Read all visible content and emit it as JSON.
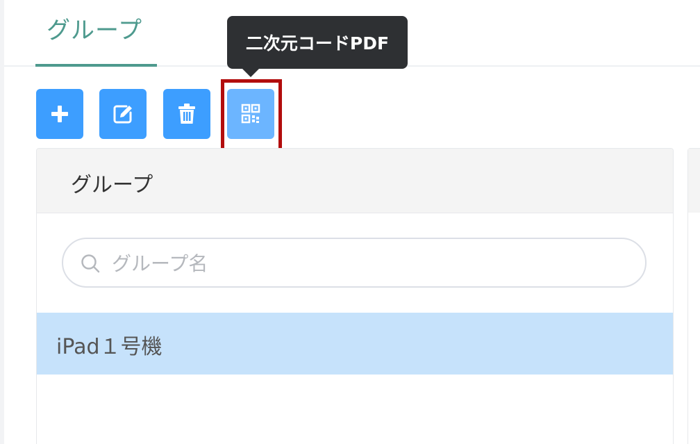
{
  "tabs": [
    {
      "label": "グループ",
      "active": true
    }
  ],
  "tooltip": {
    "text": "二次元コードPDF"
  },
  "toolbar": {
    "buttons": [
      {
        "name": "add",
        "icon": "plus-icon"
      },
      {
        "name": "edit",
        "icon": "edit-icon"
      },
      {
        "name": "delete",
        "icon": "trash-icon"
      },
      {
        "name": "qr-pdf",
        "icon": "qr-code-icon",
        "hovered": true,
        "highlighted": true
      }
    ],
    "button_color": "#3d9eff",
    "button_hover_color": "#6cb5ff",
    "highlight_color": "#b20d0d"
  },
  "panel": {
    "title": "グループ",
    "search": {
      "placeholder": "グループ名",
      "value": "",
      "icon": "search-icon"
    },
    "items": [
      {
        "label": "iPad１号機",
        "selected": true
      }
    ]
  },
  "colors": {
    "accent": "#4e9a8e",
    "selected_row": "#c6e2fb",
    "tooltip_bg": "#2e3033"
  }
}
